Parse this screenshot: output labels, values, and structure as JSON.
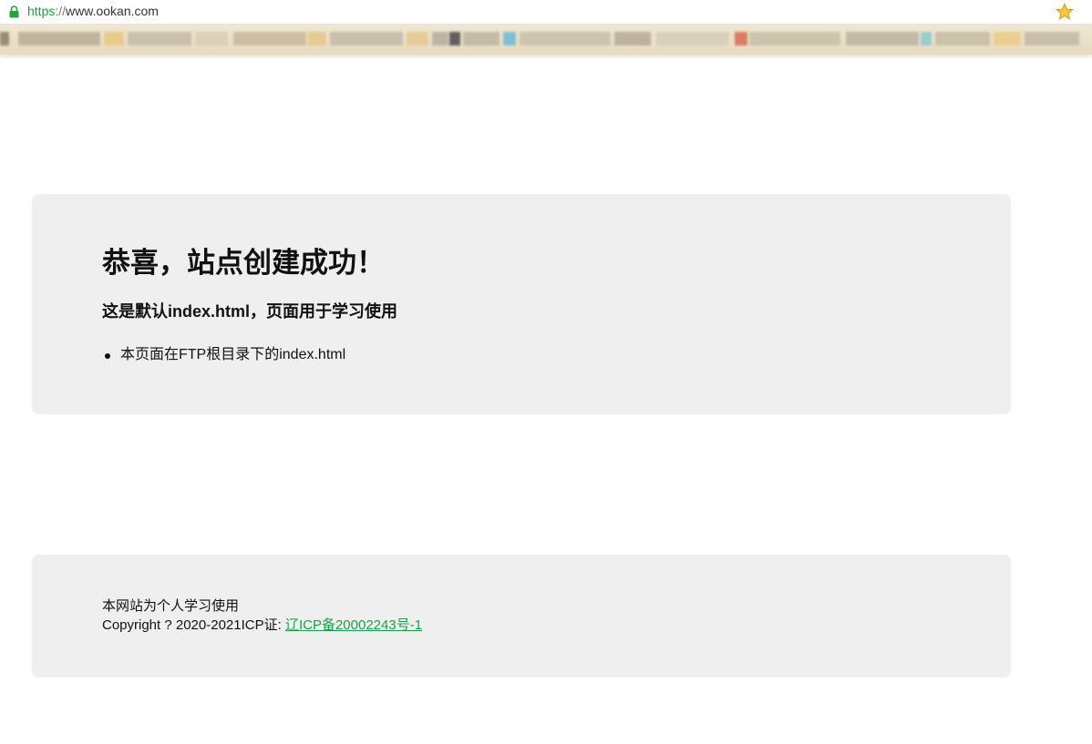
{
  "browser": {
    "url_scheme": "https",
    "url_separator": "://",
    "url_host": "www.ookan.com",
    "lock_icon": "lock-icon",
    "bookmark_icon": "star-icon",
    "scheme_color": "#1c9e3a"
  },
  "main": {
    "title": "恭喜，站点创建成功！",
    "subtitle": "这是默认index.html，页面用于学习使用",
    "bullets": [
      "本页面在FTP根目录下的index.html"
    ]
  },
  "footer": {
    "line1": "本网站为个人学习使用",
    "copyright_prefix": "Copyright ? 2020-2021ICP证: ",
    "icp_link": "辽ICP备20002243号-1",
    "link_color": "#1a9f4b"
  }
}
